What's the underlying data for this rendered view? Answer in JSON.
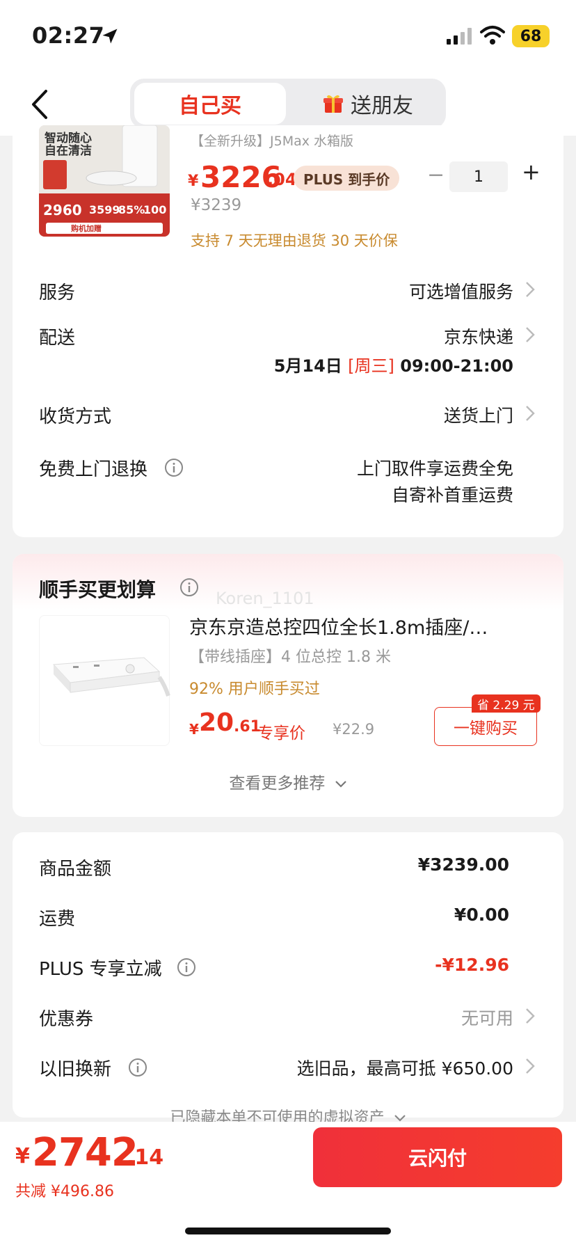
{
  "status": {
    "time": "02:27",
    "battery": "68"
  },
  "nav": {
    "tab_self": "自己买",
    "tab_gift": "送朋友"
  },
  "product": {
    "image_lines": [
      "智动随心",
      "自在清洁",
      "2960",
      "3599",
      "85%",
      "100",
      "购机加赠"
    ],
    "subtitle": "【全新升级】J5Max 水箱版",
    "price_symbol": "¥",
    "price_int": "3226",
    "price_dec": ".04",
    "plus_tag": "PLUS 到手价",
    "orig_price": "¥3239",
    "quantity": "1",
    "policy": "支持 7 天无理由退货   30 天价保"
  },
  "rows": {
    "service_label": "服务",
    "service_value": "可选增值服务",
    "delivery_label": "配送",
    "delivery_value": "京东快递",
    "delivery_date": "5月14日",
    "delivery_weekday": "[周三]",
    "delivery_time": "09:00-21:00",
    "receive_label": "收货方式",
    "receive_value": "送货上门",
    "return_label": "免费上门退换",
    "return_line1": "上门取件享运费全免",
    "return_line2": "自寄补首重运费"
  },
  "upsell": {
    "title": "顺手买更划算",
    "watermark": "Koren_1101",
    "item_title": "京东京造总控四位全长1.8m插座/…",
    "item_sub": "【带线插座】4 位总控 1.8 米",
    "item_pct": "92% 用户顺手买过",
    "yen": "¥",
    "price_int": "20",
    "price_dec": ".61",
    "exclusive": "专享价",
    "orig": "¥22.9",
    "save_tag": "省 2.29 元",
    "buy_btn": "一键购买",
    "more": "查看更多推荐"
  },
  "summary": {
    "goods_label": "商品金额",
    "goods_value": "¥3239.00",
    "ship_label": "运费",
    "ship_value": "¥0.00",
    "plus_label": "PLUS 专享立减",
    "plus_value": "-¥12.96",
    "coupon_label": "优惠券",
    "coupon_value": "无可用",
    "tradein_label": "以旧换新",
    "tradein_value": "选旧品，最高可抵 ¥650.00",
    "hidden_assets": "已隐藏本单不可使用的虚拟资产"
  },
  "bottom": {
    "yen": "¥",
    "total_int": "2742",
    "total_dec": ".14",
    "saved": "共减 ¥496.86",
    "pay_btn": "云闪付"
  },
  "colors": {
    "accent": "#e8321f",
    "gold": "#c88a2e"
  }
}
